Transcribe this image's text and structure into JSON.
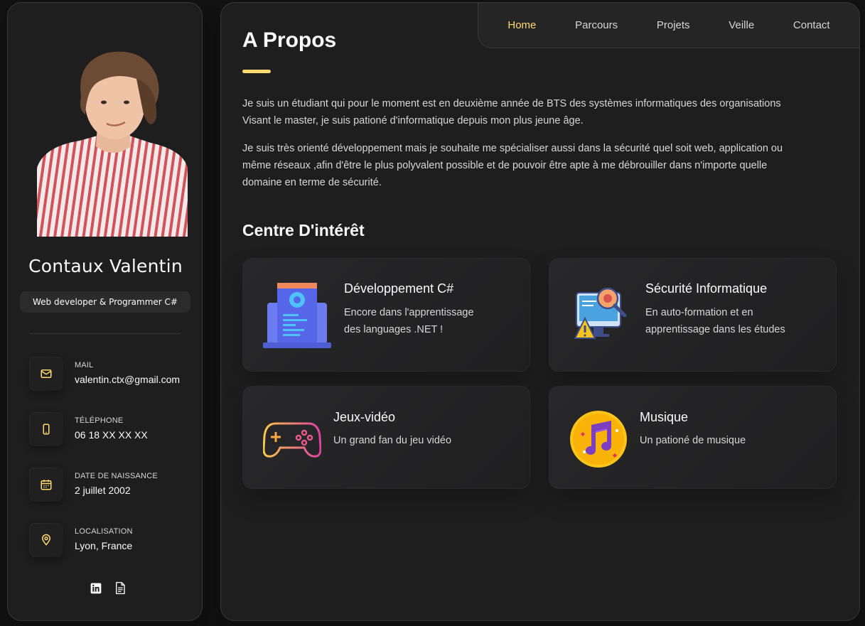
{
  "sidebar": {
    "name": "Contaux Valentin",
    "title": "Web developer & Programmer C#",
    "contacts": [
      {
        "label": "Mail",
        "value": "valentin.ctx@gmail.com",
        "icon": "mail-icon"
      },
      {
        "label": "Téléphone",
        "value": "06 18 XX XX XX",
        "icon": "phone-icon"
      },
      {
        "label": "Date de naissance",
        "value": "2 juillet 2002",
        "icon": "calendar-icon"
      },
      {
        "label": "Localisation",
        "value": "Lyon, France",
        "icon": "location-icon"
      }
    ],
    "socials": [
      {
        "name": "linkedin-icon"
      },
      {
        "name": "document-icon"
      }
    ]
  },
  "nav": {
    "items": [
      "Home",
      "Parcours",
      "Projets",
      "Veille",
      "Contact"
    ],
    "active": "Home"
  },
  "about": {
    "title": "A Propos",
    "paragraphs": [
      "Je suis un étudiant qui pour le moment est en deuxième année de BTS des systèmes informatiques des organisations Visant le master, je suis pationé d'informatique depuis mon plus jeune âge.",
      "Je suis très orienté développement mais je souhaite me spécialiser aussi dans la sécurité quel soit web, application ou même réseaux ,afin d'être le plus polyvalent possible et de pouvoir être apte à me débrouiller dans n'importe quelle domaine en terme de sécurité."
    ]
  },
  "interests": {
    "title": "Centre D'intérêt",
    "cards": [
      {
        "title": "Développement C#",
        "text_lines": [
          "Encore dans l'apprentissage",
          "des languages .NET !"
        ],
        "icon": "laptop-code-icon"
      },
      {
        "title": "Sécurité Informatique",
        "text_lines": [
          "En auto-formation et en",
          "apprentissage dans les études"
        ],
        "icon": "security-bug-icon"
      },
      {
        "title": "Jeux-vidéo",
        "text_lines": [
          "Un grand fan du jeu vidéo"
        ],
        "icon": "gamepad-icon"
      },
      {
        "title": "Musique",
        "text_lines": [
          "Un pationé de musique"
        ],
        "icon": "music-note-icon"
      }
    ]
  },
  "colors": {
    "accent": "#ffdb70",
    "background": "#121212",
    "panel": "#1e1e1f"
  }
}
